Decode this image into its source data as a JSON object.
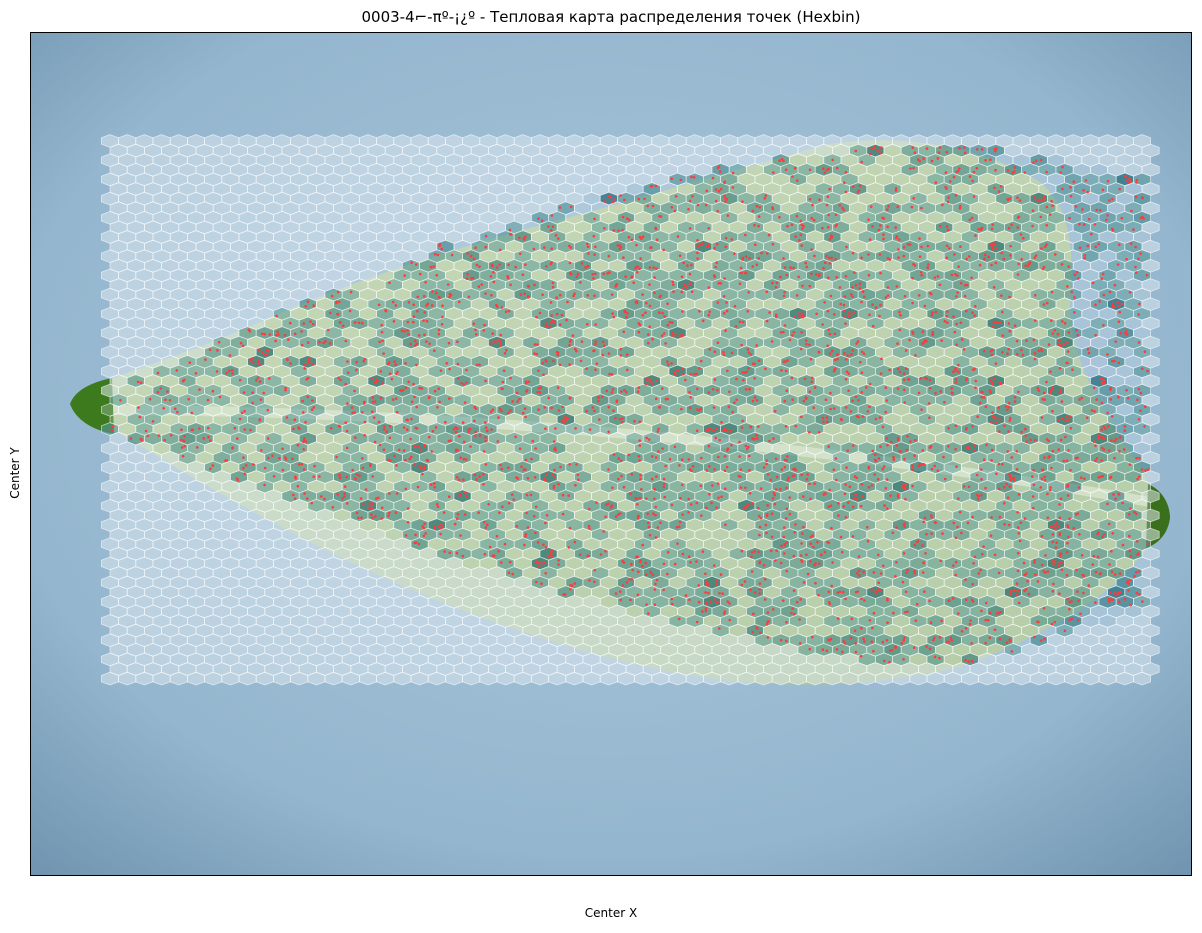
{
  "chart_data": {
    "type": "heatmap",
    "subtype": "hexbin",
    "title": "0003-4⌐-πº-¡¿º - Тепловая карта распределения точек (Hexbin)",
    "xlabel": "Center X",
    "ylabel": "Center Y",
    "ticks": "none",
    "background": "photograph of a leaf",
    "colors": {
      "background_blue": "#8fb2cc",
      "leaf_green": "#b6cc96",
      "hex_empty": "#dce8ef",
      "hex_dense": "#0b5e6a",
      "hex_edge": "#ffffff",
      "point": "#ff3b3b"
    },
    "point_count_estimate": 900,
    "bin_count_range": [
      0,
      6
    ]
  }
}
